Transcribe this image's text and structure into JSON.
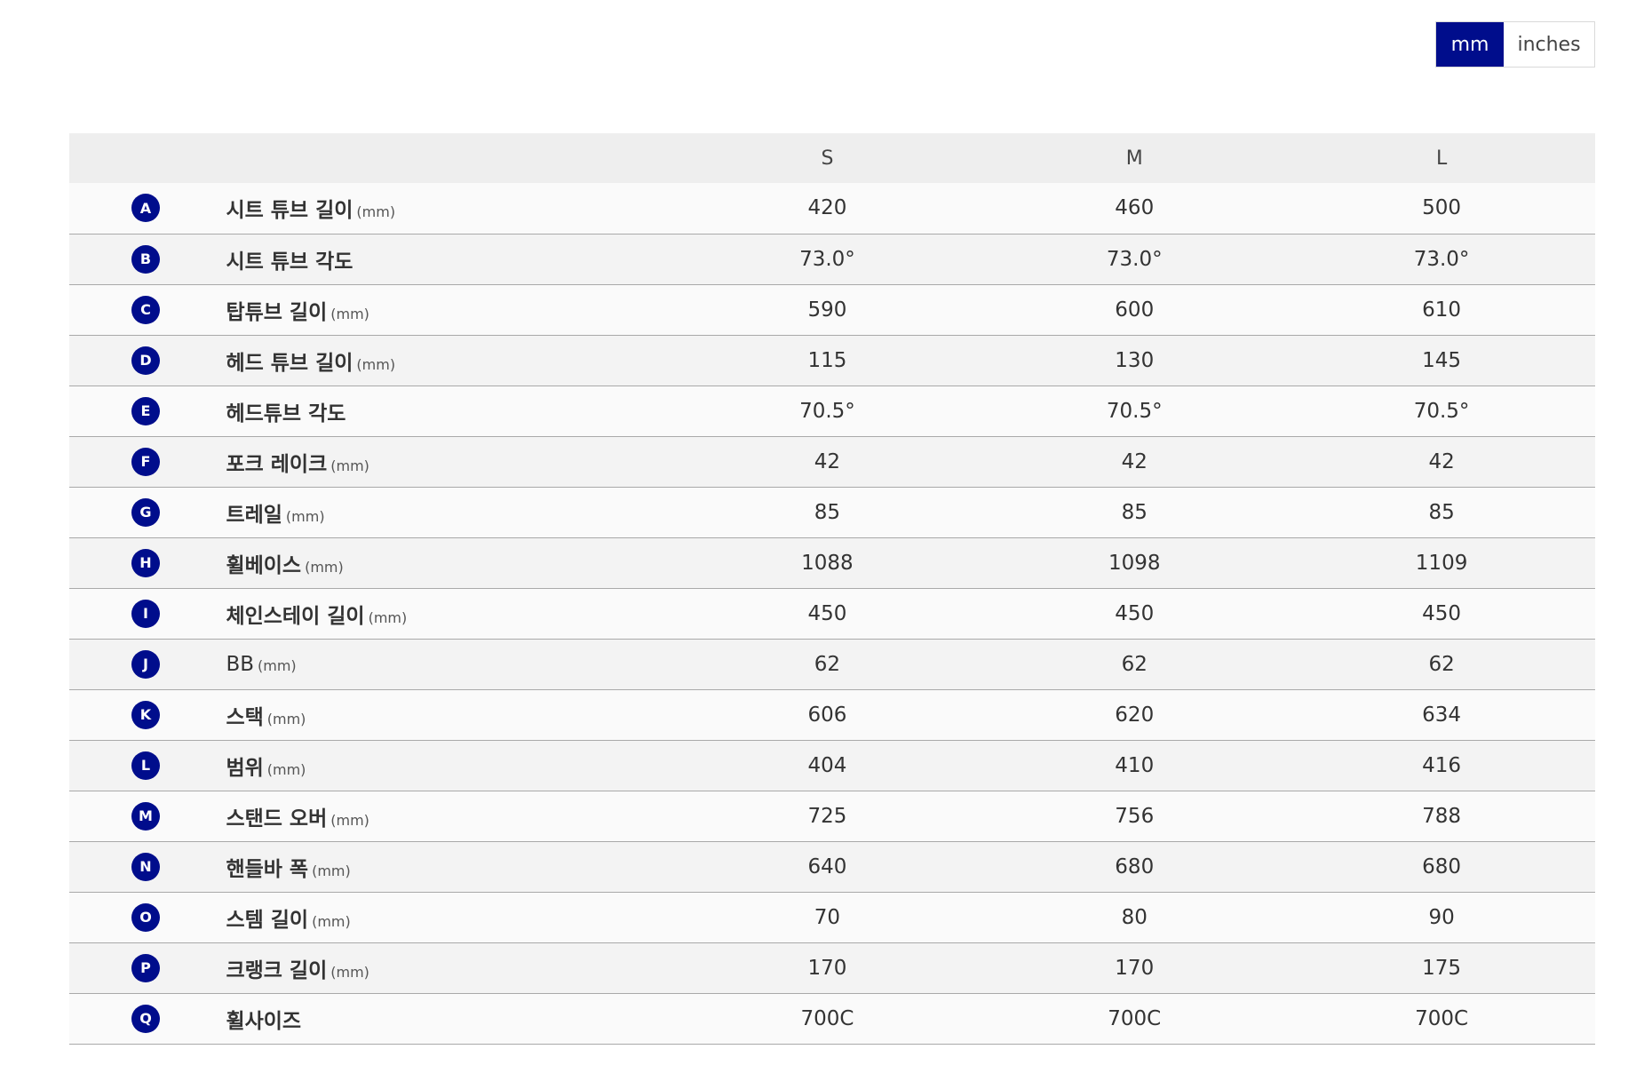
{
  "unit_toggle": {
    "mm_label": "mm",
    "inches_label": "inches",
    "active": "mm"
  },
  "table": {
    "columns": [
      "",
      "",
      "S",
      "M",
      "L"
    ],
    "rows": [
      {
        "letter": "A",
        "name": "시트 튜브 길이",
        "unit": "(mm)",
        "values": [
          "420",
          "460",
          "500"
        ]
      },
      {
        "letter": "B",
        "name": "시트 튜브 각도",
        "unit": "",
        "values": [
          "73.0°",
          "73.0°",
          "73.0°"
        ]
      },
      {
        "letter": "C",
        "name": "탑튜브 길이",
        "unit": "(mm)",
        "values": [
          "590",
          "600",
          "610"
        ]
      },
      {
        "letter": "D",
        "name": "헤드 튜브 길이",
        "unit": "(mm)",
        "values": [
          "115",
          "130",
          "145"
        ]
      },
      {
        "letter": "E",
        "name": "헤드튜브 각도",
        "unit": "",
        "values": [
          "70.5°",
          "70.5°",
          "70.5°"
        ]
      },
      {
        "letter": "F",
        "name": "포크 레이크",
        "unit": "(mm)",
        "values": [
          "42",
          "42",
          "42"
        ]
      },
      {
        "letter": "G",
        "name": "트레일",
        "unit": "(mm)",
        "values": [
          "85",
          "85",
          "85"
        ]
      },
      {
        "letter": "H",
        "name": "휠베이스",
        "unit": "(mm)",
        "values": [
          "1088",
          "1098",
          "1109"
        ]
      },
      {
        "letter": "I",
        "name": "체인스테이 길이",
        "unit": "(mm)",
        "values": [
          "450",
          "450",
          "450"
        ]
      },
      {
        "letter": "J",
        "name": "BB",
        "unit": "(mm)",
        "values": [
          "62",
          "62",
          "62"
        ]
      },
      {
        "letter": "K",
        "name": "스택",
        "unit": "(mm)",
        "values": [
          "606",
          "620",
          "634"
        ]
      },
      {
        "letter": "L",
        "name": "범위",
        "unit": "(mm)",
        "values": [
          "404",
          "410",
          "416"
        ]
      },
      {
        "letter": "M",
        "name": "스탠드 오버",
        "unit": "(mm)",
        "values": [
          "725",
          "756",
          "788"
        ]
      },
      {
        "letter": "N",
        "name": "핸들바 폭",
        "unit": "(mm)",
        "values": [
          "640",
          "680",
          "680"
        ]
      },
      {
        "letter": "O",
        "name": "스템 길이",
        "unit": "(mm)",
        "values": [
          "70",
          "80",
          "90"
        ]
      },
      {
        "letter": "P",
        "name": "크랭크 길이",
        "unit": "(mm)",
        "values": [
          "170",
          "170",
          "175"
        ]
      },
      {
        "letter": "Q",
        "name": "휠사이즈",
        "unit": "",
        "values": [
          "700C",
          "700C",
          "700C"
        ]
      }
    ]
  },
  "colors": {
    "accent": "#000d8c"
  }
}
